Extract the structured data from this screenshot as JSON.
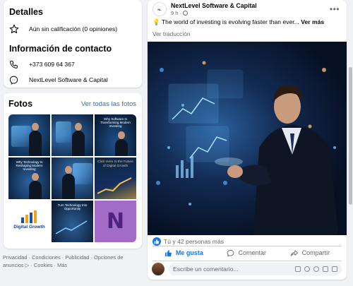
{
  "details": {
    "title": "Detalles",
    "rating": "Aún sin calificación (0 opiniones)"
  },
  "contact": {
    "title": "Información de contacto",
    "phone": "+373 609 64 367",
    "messenger": "NextLevel Software & Capital"
  },
  "photos": {
    "title": "Fotos",
    "see_all": "Ver todas las fotos",
    "tiles": [
      {
        "caption": ""
      },
      {
        "caption": ""
      },
      {
        "caption": "Why Software Is Transforming Modern Investing"
      },
      {
        "caption": "Why Technology Is Reshaping Modern Investing"
      },
      {
        "caption": ""
      },
      {
        "caption": "Click Here to the Future of Digital Growth"
      },
      {
        "caption": "Digital Growth"
      },
      {
        "caption": "Turn Technology Into Opportunity"
      },
      {
        "caption": "N"
      }
    ]
  },
  "footer": {
    "links": "Privacidad · Condiciones · Publicidad · Opciones de anuncios ▷ · Cookies · Más"
  },
  "post": {
    "author": "NextLevel Software & Capital",
    "time": "9 h ·",
    "text": "💡 The world of investing is evolving faster than ever...",
    "see_more": "Ver más",
    "translate": "Ver traducción",
    "reactions": "Tú y 42 personas más",
    "like": "Me gusta",
    "comment": "Comentar",
    "share": "Compartir",
    "comment_placeholder": "Escribe un comentario..."
  },
  "colors": {
    "accent": "#1b74e4",
    "link": "#216fdb",
    "muted": "#65676b"
  }
}
